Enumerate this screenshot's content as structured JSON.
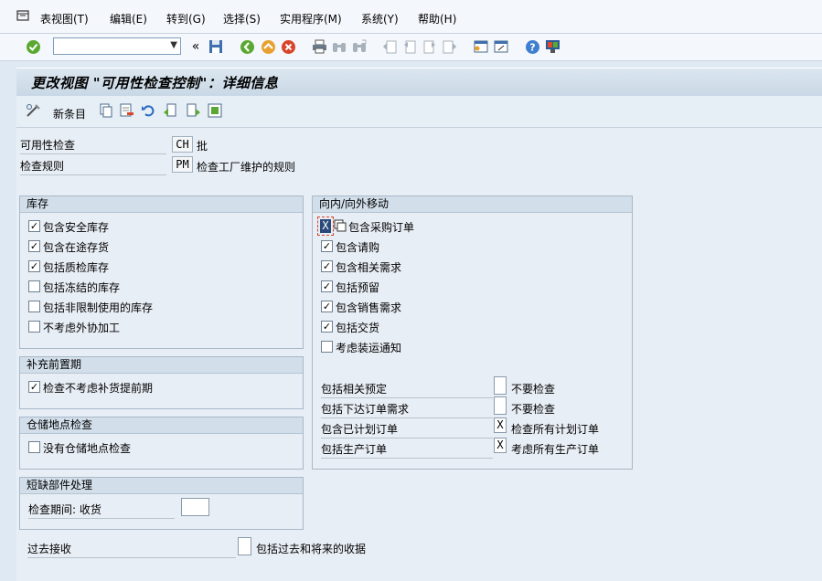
{
  "menu": {
    "items": [
      "表视图(T)",
      "编辑(E)",
      "转到(G)",
      "选择(S)",
      "实用程序(M)",
      "系统(Y)",
      "帮助(H)"
    ]
  },
  "toolbar": {
    "command_value": ""
  },
  "title": "更改视图 \"可用性检查控制\"：详细信息",
  "app_toolbar": {
    "new_entries": "新条目"
  },
  "fields": {
    "availability_check": {
      "label": "可用性检查",
      "value": "CH",
      "text": "批"
    },
    "checking_rule": {
      "label": "检查规则",
      "value": "PM",
      "text": "检查工厂维护的规则"
    }
  },
  "stock": {
    "title": "库存",
    "items": [
      {
        "label": "包含安全库存",
        "checked": "✓"
      },
      {
        "label": "包含在途存货",
        "checked": "✓"
      },
      {
        "label": "包括质检库存",
        "checked": "✓"
      },
      {
        "label": "包括冻结的库存",
        "checked": ""
      },
      {
        "label": "包括非限制使用的库存",
        "checked": ""
      },
      {
        "label": "不考虑外协加工",
        "checked": ""
      }
    ]
  },
  "replenishment": {
    "title": "补充前置期",
    "item": {
      "label": "检查不考虑补货提前期",
      "checked": "✓"
    }
  },
  "storage": {
    "title": "仓储地点检查",
    "item": {
      "label": "没有仓储地点检查",
      "checked": ""
    }
  },
  "missing_parts": {
    "title": "短缺部件处理",
    "period_label": "检查期间: 收货",
    "period_value": ""
  },
  "past_receipts": {
    "label": "过去接收",
    "value": "",
    "text": "包括过去和将来的收据"
  },
  "movements": {
    "title": "向内/向外移动",
    "first": {
      "value": "X",
      "label": "包含采购订单"
    },
    "items": [
      {
        "label": "包含请购",
        "checked": "✓"
      },
      {
        "label": "包含相关需求",
        "checked": "✓"
      },
      {
        "label": "包括预留",
        "checked": "✓"
      },
      {
        "label": "包含销售需求",
        "checked": "✓"
      },
      {
        "label": "包括交货",
        "checked": "✓"
      },
      {
        "label": "考虑装运通知",
        "checked": ""
      }
    ],
    "rows": [
      {
        "label": "包括相关预定",
        "value": "",
        "text": "不要检查"
      },
      {
        "label": "包括下达订单需求",
        "value": "",
        "text": "不要检查"
      },
      {
        "label": "包含已计划订单",
        "value": "X",
        "text": "检查所有计划订单"
      },
      {
        "label": "包括生产订单",
        "value": "X",
        "text": "考虑所有生产订单"
      }
    ]
  }
}
